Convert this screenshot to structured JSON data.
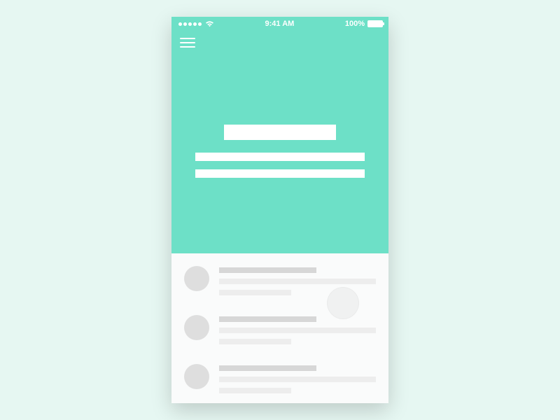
{
  "colors": {
    "page_bg": "#e6f7f2",
    "hero_bg": "#6de0c7",
    "placeholder_light": "#ededed",
    "placeholder_med": "#d7d7d7",
    "avatar_bg": "#dedede"
  },
  "status_bar": {
    "time": "9:41 AM",
    "battery_label": "100%",
    "signal_icon": "cellular-signal-icon",
    "wifi_icon": "wifi-icon",
    "battery_icon": "battery-full-icon"
  },
  "nav": {
    "menu_icon": "hamburger-icon"
  },
  "hero": {
    "title_placeholder": "",
    "line1_placeholder": "",
    "line2_placeholder": ""
  },
  "list": {
    "items": [
      {
        "avatar": "",
        "line1": "",
        "line2": "",
        "line3": ""
      },
      {
        "avatar": "",
        "line1": "",
        "line2": "",
        "line3": ""
      },
      {
        "avatar": "",
        "line1": "",
        "line2": "",
        "line3": ""
      }
    ]
  },
  "touch_indicator": {
    "visible": true
  }
}
